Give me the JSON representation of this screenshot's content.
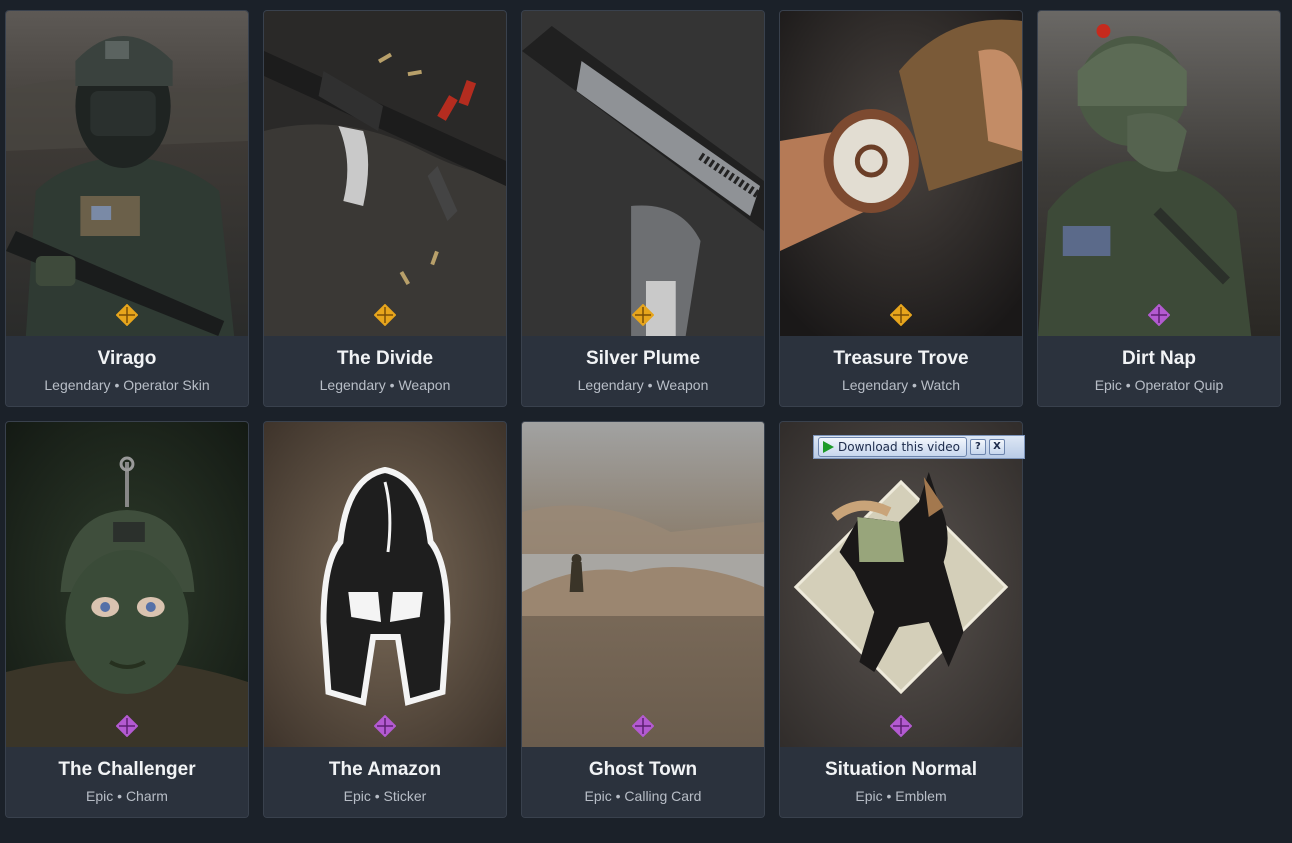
{
  "popup": {
    "download_label": "Download this video",
    "help_label": "?",
    "close_label": "X"
  },
  "cards": [
    {
      "title": "Virago",
      "subtitle": "Legendary • Operator Skin",
      "rarity": "legendary"
    },
    {
      "title": "The Divide",
      "subtitle": "Legendary • Weapon",
      "rarity": "legendary"
    },
    {
      "title": "Silver Plume",
      "subtitle": "Legendary • Weapon",
      "rarity": "legendary"
    },
    {
      "title": "Treasure Trove",
      "subtitle": "Legendary • Watch",
      "rarity": "legendary"
    },
    {
      "title": "Dirt Nap",
      "subtitle": "Epic • Operator Quip",
      "rarity": "epic"
    },
    {
      "title": "The Challenger",
      "subtitle": "Epic • Charm",
      "rarity": "epic"
    },
    {
      "title": "The Amazon",
      "subtitle": "Epic • Sticker",
      "rarity": "epic"
    },
    {
      "title": "Ghost Town",
      "subtitle": "Epic • Calling Card",
      "rarity": "epic"
    },
    {
      "title": "Situation Normal",
      "subtitle": "Epic • Emblem",
      "rarity": "epic"
    }
  ],
  "colors": {
    "page_bg": "#1b2129",
    "card_bg": "#2b323d",
    "legendary": "#e7a51c",
    "epic": "#b35ad1"
  },
  "icons": [
    "legendary-rarity-icon",
    "epic-rarity-icon",
    "play-icon",
    "help-icon",
    "close-icon"
  ]
}
